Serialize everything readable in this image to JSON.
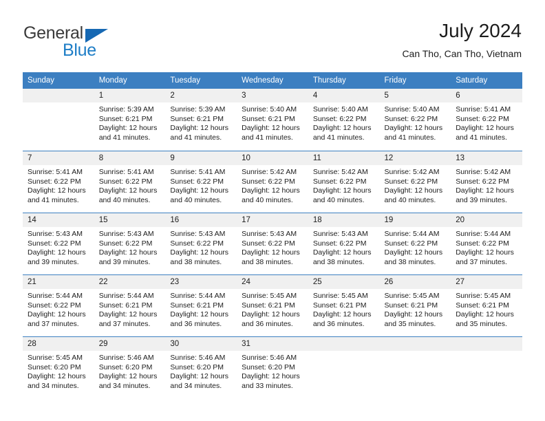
{
  "brand": {
    "name_part1": "General",
    "name_part2": "Blue",
    "triangle_color": "#1668b3",
    "blue_color": "#1d7dc6"
  },
  "header": {
    "title": "July 2024",
    "subtitle": "Can Tho, Can Tho, Vietnam"
  },
  "theme": {
    "header_bg": "#3c7fc1",
    "daynum_bg": "#f0f0f0",
    "grid_line": "#3c7fc1",
    "text": "#1c1c1c"
  },
  "weekdays": [
    "Sunday",
    "Monday",
    "Tuesday",
    "Wednesday",
    "Thursday",
    "Friday",
    "Saturday"
  ],
  "labels": {
    "sunrise_prefix": "Sunrise:",
    "sunset_prefix": "Sunset:",
    "daylight_prefix": "Daylight:"
  },
  "weeks": [
    [
      {
        "day": "",
        "empty": true,
        "sunrise": "",
        "sunset": "",
        "daylight_line1": "",
        "daylight_line2": ""
      },
      {
        "day": "1",
        "sunrise": "Sunrise: 5:39 AM",
        "sunset": "Sunset: 6:21 PM",
        "daylight_line1": "Daylight: 12 hours",
        "daylight_line2": "and 41 minutes."
      },
      {
        "day": "2",
        "sunrise": "Sunrise: 5:39 AM",
        "sunset": "Sunset: 6:21 PM",
        "daylight_line1": "Daylight: 12 hours",
        "daylight_line2": "and 41 minutes."
      },
      {
        "day": "3",
        "sunrise": "Sunrise: 5:40 AM",
        "sunset": "Sunset: 6:21 PM",
        "daylight_line1": "Daylight: 12 hours",
        "daylight_line2": "and 41 minutes."
      },
      {
        "day": "4",
        "sunrise": "Sunrise: 5:40 AM",
        "sunset": "Sunset: 6:22 PM",
        "daylight_line1": "Daylight: 12 hours",
        "daylight_line2": "and 41 minutes."
      },
      {
        "day": "5",
        "sunrise": "Sunrise: 5:40 AM",
        "sunset": "Sunset: 6:22 PM",
        "daylight_line1": "Daylight: 12 hours",
        "daylight_line2": "and 41 minutes."
      },
      {
        "day": "6",
        "sunrise": "Sunrise: 5:41 AM",
        "sunset": "Sunset: 6:22 PM",
        "daylight_line1": "Daylight: 12 hours",
        "daylight_line2": "and 41 minutes."
      }
    ],
    [
      {
        "day": "7",
        "sunrise": "Sunrise: 5:41 AM",
        "sunset": "Sunset: 6:22 PM",
        "daylight_line1": "Daylight: 12 hours",
        "daylight_line2": "and 41 minutes."
      },
      {
        "day": "8",
        "sunrise": "Sunrise: 5:41 AM",
        "sunset": "Sunset: 6:22 PM",
        "daylight_line1": "Daylight: 12 hours",
        "daylight_line2": "and 40 minutes."
      },
      {
        "day": "9",
        "sunrise": "Sunrise: 5:41 AM",
        "sunset": "Sunset: 6:22 PM",
        "daylight_line1": "Daylight: 12 hours",
        "daylight_line2": "and 40 minutes."
      },
      {
        "day": "10",
        "sunrise": "Sunrise: 5:42 AM",
        "sunset": "Sunset: 6:22 PM",
        "daylight_line1": "Daylight: 12 hours",
        "daylight_line2": "and 40 minutes."
      },
      {
        "day": "11",
        "sunrise": "Sunrise: 5:42 AM",
        "sunset": "Sunset: 6:22 PM",
        "daylight_line1": "Daylight: 12 hours",
        "daylight_line2": "and 40 minutes."
      },
      {
        "day": "12",
        "sunrise": "Sunrise: 5:42 AM",
        "sunset": "Sunset: 6:22 PM",
        "daylight_line1": "Daylight: 12 hours",
        "daylight_line2": "and 40 minutes."
      },
      {
        "day": "13",
        "sunrise": "Sunrise: 5:42 AM",
        "sunset": "Sunset: 6:22 PM",
        "daylight_line1": "Daylight: 12 hours",
        "daylight_line2": "and 39 minutes."
      }
    ],
    [
      {
        "day": "14",
        "sunrise": "Sunrise: 5:43 AM",
        "sunset": "Sunset: 6:22 PM",
        "daylight_line1": "Daylight: 12 hours",
        "daylight_line2": "and 39 minutes."
      },
      {
        "day": "15",
        "sunrise": "Sunrise: 5:43 AM",
        "sunset": "Sunset: 6:22 PM",
        "daylight_line1": "Daylight: 12 hours",
        "daylight_line2": "and 39 minutes."
      },
      {
        "day": "16",
        "sunrise": "Sunrise: 5:43 AM",
        "sunset": "Sunset: 6:22 PM",
        "daylight_line1": "Daylight: 12 hours",
        "daylight_line2": "and 38 minutes."
      },
      {
        "day": "17",
        "sunrise": "Sunrise: 5:43 AM",
        "sunset": "Sunset: 6:22 PM",
        "daylight_line1": "Daylight: 12 hours",
        "daylight_line2": "and 38 minutes."
      },
      {
        "day": "18",
        "sunrise": "Sunrise: 5:43 AM",
        "sunset": "Sunset: 6:22 PM",
        "daylight_line1": "Daylight: 12 hours",
        "daylight_line2": "and 38 minutes."
      },
      {
        "day": "19",
        "sunrise": "Sunrise: 5:44 AM",
        "sunset": "Sunset: 6:22 PM",
        "daylight_line1": "Daylight: 12 hours",
        "daylight_line2": "and 38 minutes."
      },
      {
        "day": "20",
        "sunrise": "Sunrise: 5:44 AM",
        "sunset": "Sunset: 6:22 PM",
        "daylight_line1": "Daylight: 12 hours",
        "daylight_line2": "and 37 minutes."
      }
    ],
    [
      {
        "day": "21",
        "sunrise": "Sunrise: 5:44 AM",
        "sunset": "Sunset: 6:22 PM",
        "daylight_line1": "Daylight: 12 hours",
        "daylight_line2": "and 37 minutes."
      },
      {
        "day": "22",
        "sunrise": "Sunrise: 5:44 AM",
        "sunset": "Sunset: 6:21 PM",
        "daylight_line1": "Daylight: 12 hours",
        "daylight_line2": "and 37 minutes."
      },
      {
        "day": "23",
        "sunrise": "Sunrise: 5:44 AM",
        "sunset": "Sunset: 6:21 PM",
        "daylight_line1": "Daylight: 12 hours",
        "daylight_line2": "and 36 minutes."
      },
      {
        "day": "24",
        "sunrise": "Sunrise: 5:45 AM",
        "sunset": "Sunset: 6:21 PM",
        "daylight_line1": "Daylight: 12 hours",
        "daylight_line2": "and 36 minutes."
      },
      {
        "day": "25",
        "sunrise": "Sunrise: 5:45 AM",
        "sunset": "Sunset: 6:21 PM",
        "daylight_line1": "Daylight: 12 hours",
        "daylight_line2": "and 36 minutes."
      },
      {
        "day": "26",
        "sunrise": "Sunrise: 5:45 AM",
        "sunset": "Sunset: 6:21 PM",
        "daylight_line1": "Daylight: 12 hours",
        "daylight_line2": "and 35 minutes."
      },
      {
        "day": "27",
        "sunrise": "Sunrise: 5:45 AM",
        "sunset": "Sunset: 6:21 PM",
        "daylight_line1": "Daylight: 12 hours",
        "daylight_line2": "and 35 minutes."
      }
    ],
    [
      {
        "day": "28",
        "sunrise": "Sunrise: 5:45 AM",
        "sunset": "Sunset: 6:20 PM",
        "daylight_line1": "Daylight: 12 hours",
        "daylight_line2": "and 34 minutes."
      },
      {
        "day": "29",
        "sunrise": "Sunrise: 5:46 AM",
        "sunset": "Sunset: 6:20 PM",
        "daylight_line1": "Daylight: 12 hours",
        "daylight_line2": "and 34 minutes."
      },
      {
        "day": "30",
        "sunrise": "Sunrise: 5:46 AM",
        "sunset": "Sunset: 6:20 PM",
        "daylight_line1": "Daylight: 12 hours",
        "daylight_line2": "and 34 minutes."
      },
      {
        "day": "31",
        "sunrise": "Sunrise: 5:46 AM",
        "sunset": "Sunset: 6:20 PM",
        "daylight_line1": "Daylight: 12 hours",
        "daylight_line2": "and 33 minutes."
      },
      {
        "day": "",
        "empty": true,
        "sunrise": "",
        "sunset": "",
        "daylight_line1": "",
        "daylight_line2": ""
      },
      {
        "day": "",
        "empty": true,
        "sunrise": "",
        "sunset": "",
        "daylight_line1": "",
        "daylight_line2": ""
      },
      {
        "day": "",
        "empty": true,
        "sunrise": "",
        "sunset": "",
        "daylight_line1": "",
        "daylight_line2": ""
      }
    ]
  ]
}
